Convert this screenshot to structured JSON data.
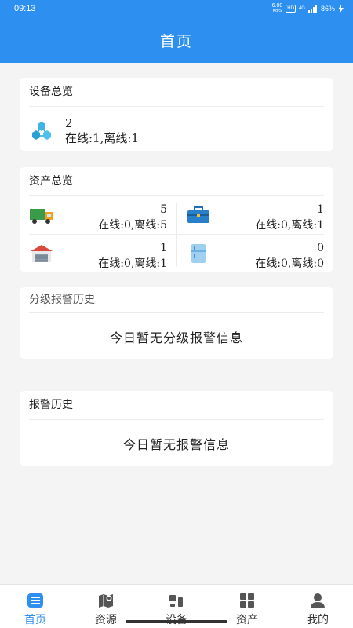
{
  "status": {
    "time": "09:13",
    "speed_top": "6.00",
    "speed_bottom": "KB/S",
    "hd": "HD",
    "signal": "4G",
    "battery": "86%"
  },
  "header": {
    "title": "首页"
  },
  "device_overview": {
    "title": "设备总览",
    "count": "2",
    "stat": "在线:1,离线:1"
  },
  "asset_overview": {
    "title": "资产总览",
    "items": [
      {
        "icon": "truck-icon",
        "count": "5",
        "stat": "在线:0,离线:5"
      },
      {
        "icon": "toolbox-icon",
        "count": "1",
        "stat": "在线:0,离线:1"
      },
      {
        "icon": "warehouse-icon",
        "count": "1",
        "stat": "在线:0,离线:1"
      },
      {
        "icon": "refrigerator-icon",
        "count": "0",
        "stat": "在线:0,离线:0"
      }
    ]
  },
  "graded_alarm": {
    "title": "分级报警历史",
    "empty": "今日暂无分级报警信息"
  },
  "alarm_history": {
    "title": "报警历史",
    "empty": "今日暂无报警信息"
  },
  "nav": {
    "items": [
      {
        "label": "首页",
        "icon": "home-list-icon",
        "active": true
      },
      {
        "label": "资源",
        "icon": "map-icon",
        "active": false
      },
      {
        "label": "设备",
        "icon": "devices-icon",
        "active": false
      },
      {
        "label": "资产",
        "icon": "grid-icon",
        "active": false
      },
      {
        "label": "我的",
        "icon": "user-icon",
        "active": false
      }
    ]
  },
  "colors": {
    "primary": "#2d8ff0",
    "background": "#f4f4f4"
  }
}
